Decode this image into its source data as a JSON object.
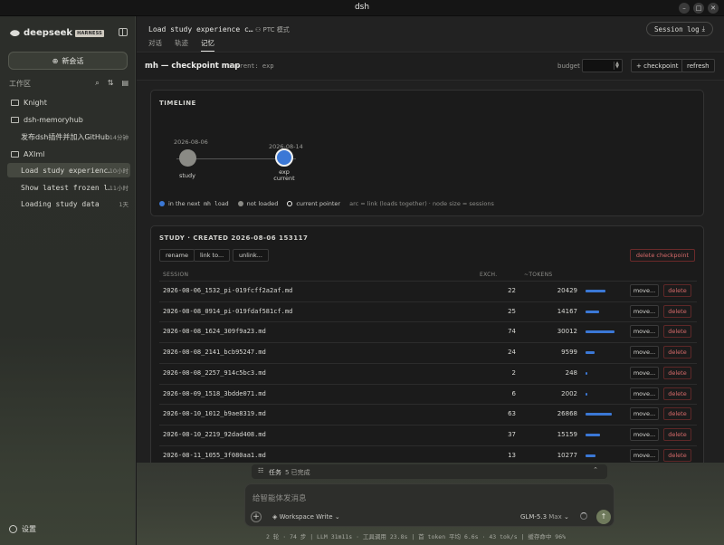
{
  "window": {
    "title": "dsh"
  },
  "brand": {
    "name": "deepseek",
    "tag": "HARNESS"
  },
  "sidebar": {
    "new_chat": "新会话",
    "workspace_label": "工作区",
    "folders": [
      {
        "name": "Knight"
      },
      {
        "name": "dsh-memoryhub"
      },
      {
        "name": "AXIml"
      }
    ],
    "files": [
      {
        "name": "发布dsh插件并加入GitHub…",
        "time": "14分钟"
      },
      {
        "name": "Load study experienc…",
        "time": "10小时"
      },
      {
        "name": "Show latest frozen l…",
        "time": "11小时"
      },
      {
        "name": "Loading study data",
        "time": "1天"
      }
    ],
    "settings": "设置"
  },
  "header": {
    "session_title": "Load study experience c…",
    "ptc": "PTC 模式",
    "tabs": [
      "对话",
      "轨迹",
      "记忆"
    ],
    "active_tab": "记忆",
    "session_log": "Session log"
  },
  "toolbar": {
    "title": "mh — checkpoint map",
    "current": "current: exp",
    "budget_label": "budget",
    "add_checkpoint": "+ checkpoint",
    "refresh": "refresh"
  },
  "timeline": {
    "heading": "TIMELINE",
    "nodes": [
      {
        "date": "2026-08-06",
        "label": "study",
        "sub": ""
      },
      {
        "date": "2026-08-14",
        "label": "exp",
        "sub": "current"
      }
    ],
    "legend": {
      "in_next": "in the next",
      "mh": "mh",
      "load": "load",
      "not_loaded": "not loaded",
      "current_pointer": "current pointer",
      "note": "arc = link (loads together) · node size = sessions"
    },
    "colors": {
      "loaded": "#3b78d6",
      "not_loaded": "#8a8a85"
    }
  },
  "study": {
    "heading": "STUDY · CREATED 2026-08-06 153117",
    "buttons": {
      "rename": "rename",
      "link": "link to...",
      "unlink": "unlink...",
      "delete_checkpoint": "delete checkpoint"
    },
    "columns": {
      "session": "SESSION",
      "exch": "EXCH.",
      "tokens": "~TOKENS"
    },
    "move_label": "move...",
    "delete_label": "delete",
    "rows": [
      {
        "session": "2026-08-06_1532_pi-019fcff2a2af.md",
        "exch": "22",
        "tokens": "20429",
        "tokens_value": 20429
      },
      {
        "session": "2026-08-08_0914_pi-019fdaf581cf.md",
        "exch": "25",
        "tokens": "14167",
        "tokens_value": 14167
      },
      {
        "session": "2026-08-08_1624_309f9a23.md",
        "exch": "74",
        "tokens": "30012",
        "tokens_value": 30012
      },
      {
        "session": "2026-08-08_2141_bcb95247.md",
        "exch": "24",
        "tokens": "9599",
        "tokens_value": 9599
      },
      {
        "session": "2026-08-08_2257_914c5bc3.md",
        "exch": "2",
        "tokens": "248",
        "tokens_value": 248
      },
      {
        "session": "2026-08-09_1518_3bdde071.md",
        "exch": "6",
        "tokens": "2002",
        "tokens_value": 2002
      },
      {
        "session": "2026-08-10_1012_b9ae8319.md",
        "exch": "63",
        "tokens": "26868",
        "tokens_value": 26868
      },
      {
        "session": "2026-08-10_2219_92dad408.md",
        "exch": "37",
        "tokens": "15159",
        "tokens_value": 15159
      },
      {
        "session": "2026-08-11_1055_3f080aa1.md",
        "exch": "13",
        "tokens": "10277",
        "tokens_value": 10277
      }
    ]
  },
  "tasks": {
    "label": "任务",
    "count": "5 已完成"
  },
  "composer": {
    "placeholder": "给智能体发消息",
    "mode": "Workspace Write",
    "model": "GLM-5.3",
    "model_level": "Max"
  },
  "status_bar": "2 轮 · 74 步 | LLM 31m11s · 工具调用 23.8s | 首 token 平均 6.6s · 43 tok/s | 缓存命中 96%"
}
